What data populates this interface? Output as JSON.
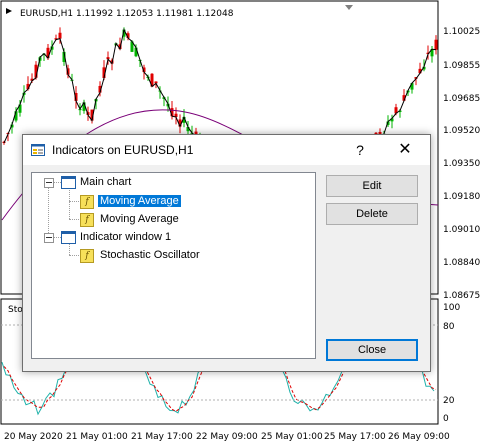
{
  "chart": {
    "title": "EURUSD,H1  1.11992 1.12053 1.11981 1.12048",
    "prices": [
      "1.10025",
      "1.09855",
      "1.09685",
      "1.09520",
      "1.09350",
      "1.09180",
      "1.09010",
      "1.08840",
      "1.08675"
    ],
    "sub_levels": [
      "100",
      "80",
      "20",
      "0"
    ],
    "sub_window_label": "Sto",
    "time_labels": [
      "20 May 2020",
      "21 May 01:00",
      "21 May 17:00",
      "22 May 09:00",
      "25 May 01:00",
      "25 May 17:00",
      "26 May 09:00"
    ],
    "colors": {
      "bull": "#00b400",
      "bear": "#e00000",
      "ma": "#7a0078",
      "stoch_main": "#20b2aa",
      "stoch_signal": "#e00000"
    }
  },
  "dialog": {
    "title": "Indicators on EURUSD,H1",
    "help": "?",
    "close": "✕",
    "tree": {
      "main_chart": "Main chart",
      "ma1": "Moving Average",
      "ma2": "Moving Average",
      "indicator_window": "Indicator window 1",
      "stochastic": "Stochastic Oscillator"
    },
    "buttons": {
      "edit": "Edit",
      "delete": "Delete",
      "close": "Close"
    }
  }
}
